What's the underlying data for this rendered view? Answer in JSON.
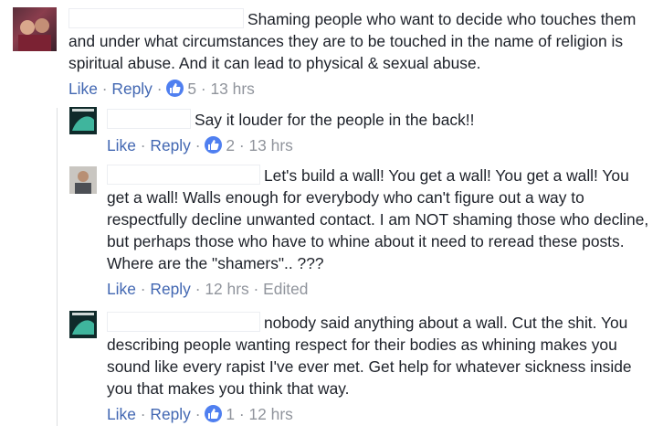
{
  "comments": [
    {
      "text": "Shaming people who want to decide who touches them and under what circumstances they are to be touched in the name of religion is spiritual abuse. And it can lead to physical & sexual abuse.",
      "like_label": "Like",
      "reply_label": "Reply",
      "like_count": "5",
      "time": "13 hrs",
      "avatar_icon": "profile-photo-icon"
    },
    {
      "text": "Say it louder for the people in the back!!",
      "like_label": "Like",
      "reply_label": "Reply",
      "like_count": "2",
      "time": "13 hrs",
      "avatar_icon": "profile-photo-icon"
    },
    {
      "text": "Let's build a wall! You get a wall! You get a wall! You get a wall! Walls enough for everybody who can't figure out a way to respectfully decline unwanted contact. I am NOT shaming those who decline, but perhaps those who have to whine about it need to reread these posts. Where are the \"shamers\".. ???",
      "like_label": "Like",
      "reply_label": "Reply",
      "time": "12 hrs",
      "edited_label": "Edited",
      "avatar_icon": "profile-photo-icon"
    },
    {
      "text": "nobody said anything about a wall. Cut the shit. You describing people wanting respect for their bodies as whining makes you sound like every rapist I've ever met. Get help for whatever sickness inside you that makes you think that way.",
      "like_label": "Like",
      "reply_label": "Reply",
      "like_count": "1",
      "time": "12 hrs",
      "avatar_icon": "profile-photo-icon"
    }
  ],
  "separator": "·",
  "colors": {
    "link": "#4267b2",
    "meta": "#90949c",
    "text": "#1d2129",
    "like_badge": "#4f7ff0"
  }
}
